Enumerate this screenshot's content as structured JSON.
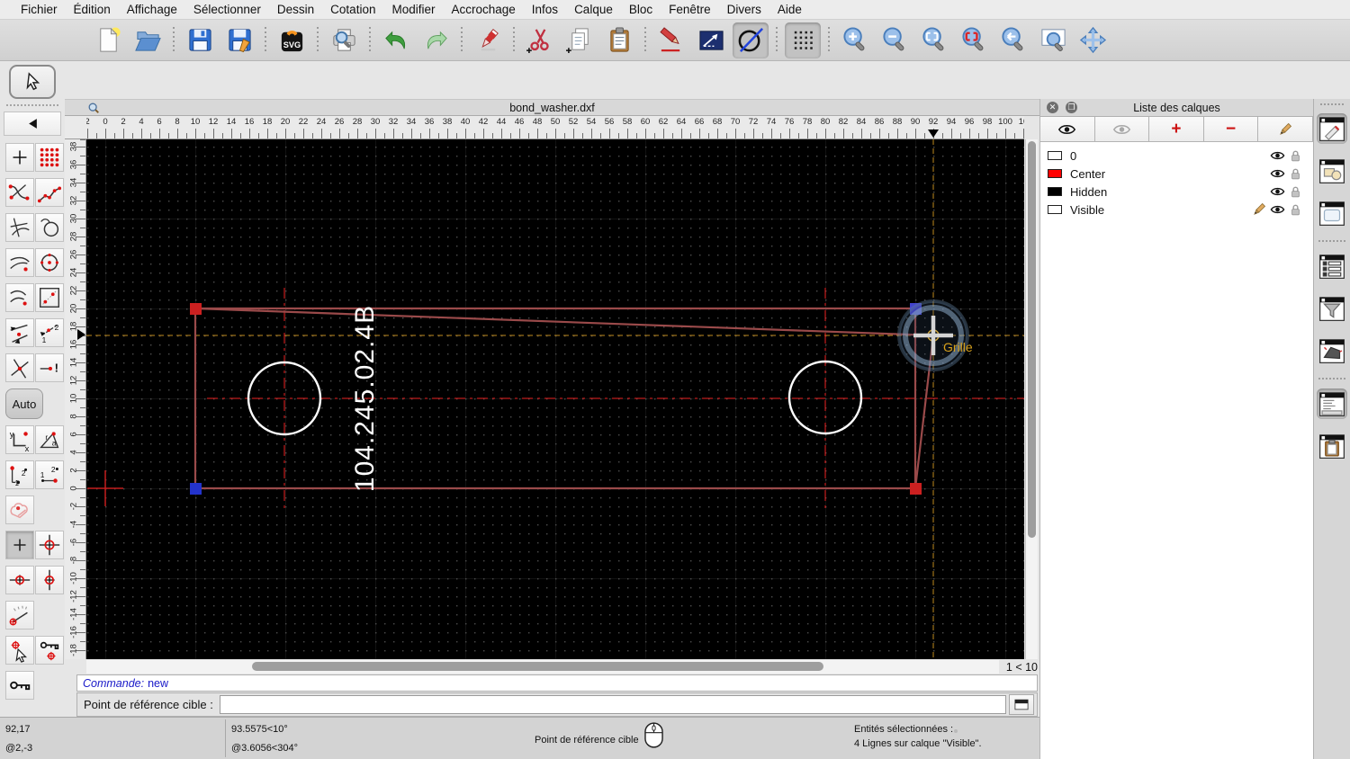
{
  "menubar": [
    "Fichier",
    "Édition",
    "Affichage",
    "Sélectionner",
    "Dessin",
    "Cotation",
    "Modifier",
    "Accrochage",
    "Infos",
    "Calque",
    "Bloc",
    "Fenêtre",
    "Divers",
    "Aide"
  ],
  "toolbar": {
    "groups": [
      [
        "new-file",
        "open-file"
      ],
      [
        "save",
        "save-as"
      ],
      [
        "export-svg"
      ],
      [
        "print-preview"
      ],
      [
        "undo",
        "redo"
      ],
      [
        "delete"
      ],
      [
        "cut",
        "copy",
        "paste"
      ],
      [
        "pen",
        "line-attributes",
        "draw-circle-line"
      ],
      [
        "grid-toggle"
      ],
      [
        "zoom-in",
        "zoom-out",
        "zoom-auto",
        "zoom-selected",
        "zoom-previous",
        "zoom-window",
        "zoom-pan"
      ]
    ],
    "pressed": [
      "draw-circle-line",
      "grid-toggle"
    ]
  },
  "left_tools": {
    "auto_label": "Auto",
    "groups": [
      {
        "items": [
          "draw-point",
          "draw-points-grid"
        ]
      },
      {
        "items": [
          "draw-spline-points",
          "draw-polyline-points"
        ]
      },
      {
        "items": [
          "draw-line-tangent",
          "draw-circle-2p"
        ]
      },
      {
        "items": [
          "draw-arc-tangent",
          "draw-circle-center"
        ]
      },
      {
        "items": [
          "draw-arcs",
          "draw-rect-points"
        ]
      },
      {
        "items": [
          "snap-two-points",
          "snap-distance-points"
        ]
      },
      {
        "items": [
          "snap-intersection",
          "snap-on-entity"
        ]
      },
      {
        "items": [
          "auto"
        ]
      },
      {
        "items": [
          "coord-cartesian",
          "coord-polar"
        ]
      },
      {
        "items": [
          "rel-cartesian",
          "rel-polar"
        ]
      },
      {
        "items": [
          "selection-shape"
        ]
      },
      {
        "items": [
          "snap-free",
          "snap-center"
        ],
        "pressed": [
          "snap-free"
        ]
      },
      {
        "items": [
          "snap-horizontal",
          "snap-vertical"
        ]
      },
      {
        "items": [
          "snap-angle"
        ]
      },
      {
        "items": [
          "snap-entity-cursor",
          "lock-relative-zero-target"
        ]
      },
      {
        "items": [
          "lock-relative-zero"
        ]
      }
    ]
  },
  "window": {
    "doc_title": "bond_washer.dxf",
    "grid_status": "1 < 10"
  },
  "rulers": {
    "top_labels": [
      "2",
      "0",
      "2",
      "4",
      "6",
      "8",
      "10",
      "12",
      "14",
      "16",
      "18",
      "20",
      "22",
      "24",
      "26",
      "28",
      "30",
      "32",
      "34",
      "36",
      "38",
      "40",
      "42",
      "44",
      "46",
      "48",
      "50",
      "52",
      "54",
      "56",
      "58",
      "60",
      "62",
      "64",
      "66",
      "68",
      "70",
      "72",
      "74",
      "76",
      "78",
      "80",
      "82",
      "84",
      "86",
      "88",
      "90",
      "92",
      "94",
      "96",
      "98",
      "100",
      "10"
    ],
    "left_labels": [
      "38",
      "36",
      "34",
      "32",
      "30",
      "28",
      "26",
      "24",
      "22",
      "20",
      "18",
      "16",
      "14",
      "12",
      "10",
      "8",
      "6",
      "4",
      "2",
      "0",
      "-2",
      "-4",
      "-6",
      "-8",
      "-10",
      "-12",
      "-14",
      "-16",
      "-18"
    ]
  },
  "canvas": {
    "part_number": "104.245.02.4B",
    "snap_label": "Grille"
  },
  "colors": {
    "selected_line": "#9a4a4a",
    "centerline": "#ee2222",
    "guide": "#bf8a1e",
    "handle_red": "#cc2020",
    "handle_blue": "#2333cc",
    "handle_violet": "#4343cf",
    "circle_white": "#ffffff",
    "snap_text": "#d9a21b",
    "command_text": "#1818c8"
  },
  "commandline": {
    "history_label": "Commande:",
    "history_value": "new",
    "prompt": "Point de référence cible :",
    "input_value": ""
  },
  "statusbar": {
    "coord_abs": "92,17",
    "coord_rel": "@2,-3",
    "polar_abs": "93.5575<10°",
    "polar_rel": "@3.6056<304°",
    "hint": "Point de référence cible",
    "selection_line1": "Entités sélectionnées :",
    "selection_line2": "4 Lignes sur calque \"Visible\"."
  },
  "layer_panel": {
    "title": "Liste des calques",
    "toolbar": [
      "show-all-layers",
      "hide-all-layers",
      "add-layer",
      "remove-layer",
      "edit-layer"
    ],
    "layers": [
      {
        "name": "0",
        "color": "#ffffff",
        "active": false
      },
      {
        "name": "Center",
        "color": "#ff0000",
        "active": false
      },
      {
        "name": "Hidden",
        "color": "#000000",
        "active": false
      },
      {
        "name": "Visible",
        "color": "#ffffff",
        "active": true
      }
    ]
  },
  "right_strip": {
    "buttons": [
      {
        "name": "dock-pen-properties",
        "pressed": true,
        "sep_before": false
      },
      {
        "name": "dock-block-list",
        "pressed": false,
        "sep_before": false
      },
      {
        "name": "dock-preview",
        "pressed": false,
        "sep_before": false
      },
      {
        "name": "dock-library-browser",
        "pressed": false,
        "sep_before": true
      },
      {
        "name": "dock-selection-filter",
        "pressed": false,
        "sep_before": false
      },
      {
        "name": "dock-wall",
        "pressed": false,
        "sep_before": false
      },
      {
        "name": "dock-command-line",
        "pressed": true,
        "sep_before": true
      },
      {
        "name": "dock-clipboard",
        "pressed": false,
        "sep_before": false
      }
    ]
  }
}
